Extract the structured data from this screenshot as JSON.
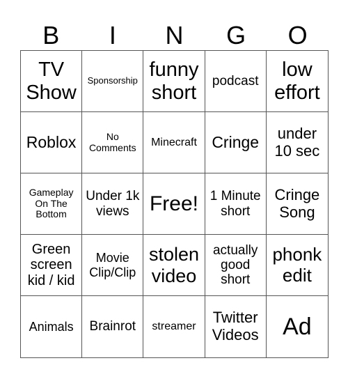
{
  "header": {
    "letters": [
      "B",
      "I",
      "N",
      "G",
      "O"
    ]
  },
  "cells": [
    "TV Show",
    "Sponsorship",
    "funny short",
    "podcast",
    "low effort",
    "Roblox",
    "No Comments",
    "Minecraft",
    "Cringe",
    "under 10 sec",
    "Gameplay On The Bottom",
    "Under 1k views",
    "Free!",
    "1 Minute short",
    "Cringe Song",
    "Green screen kid / kid",
    "Movie Clip/Clip",
    "stolen video",
    "actually good short",
    "phonk edit",
    "Animals",
    "Brainrot",
    "streamer",
    "Twitter Videos",
    "Ad"
  ]
}
